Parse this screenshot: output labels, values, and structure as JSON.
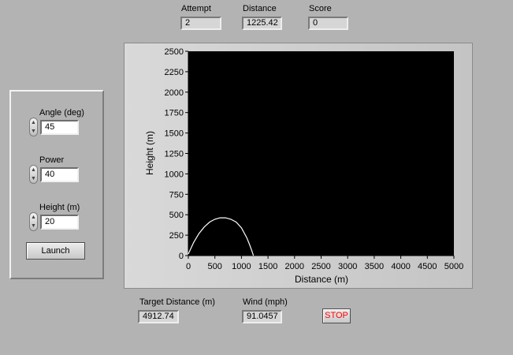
{
  "indicators": {
    "attempt": {
      "label": "Attempt",
      "value": "2"
    },
    "distance": {
      "label": "Distance",
      "value": "1225.42"
    },
    "score": {
      "label": "Score",
      "value": "0"
    }
  },
  "controls": {
    "angle": {
      "label": "Angle (deg)",
      "value": "45"
    },
    "power": {
      "label": "Power",
      "value": "40"
    },
    "height": {
      "label": "Height (m)",
      "value": "20"
    },
    "launch_label": "Launch"
  },
  "bottom": {
    "target": {
      "label": "Target Distance (m)",
      "value": "4912.74"
    },
    "wind": {
      "label": "Wind (mph)",
      "value": "91.0457"
    },
    "stop_label": "STOP"
  },
  "colors": {
    "stop_text": "#ff0000",
    "plot_bg": "#000000",
    "trace": "#ffffff"
  },
  "chart_data": {
    "type": "line",
    "title": "",
    "xlabel": "Distance (m)",
    "ylabel": "Height (m)",
    "xlim": [
      0,
      5000
    ],
    "ylim": [
      0,
      2500
    ],
    "x_ticks": [
      "0",
      "500",
      "1000",
      "1500",
      "2000",
      "2500",
      "3000",
      "3500",
      "4000",
      "4500",
      "5000"
    ],
    "y_ticks": [
      "0",
      "250",
      "500",
      "750",
      "1000",
      "1250",
      "1500",
      "1750",
      "2000",
      "2250",
      "2500"
    ],
    "grid": false,
    "series": [
      {
        "x": [
          0,
          100,
          200,
          300,
          400,
          500,
          600,
          700,
          800,
          900,
          1000,
          1100,
          1150,
          1200,
          1225
        ],
        "y": [
          20,
          160,
          270,
          350,
          410,
          445,
          462,
          462,
          445,
          410,
          340,
          220,
          140,
          50,
          0
        ]
      }
    ]
  }
}
